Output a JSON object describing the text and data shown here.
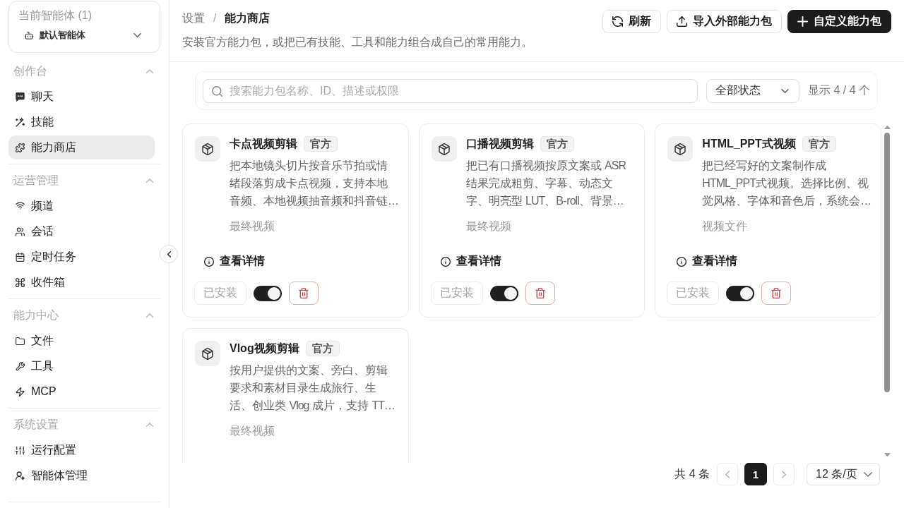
{
  "sidebar": {
    "agent_picker": {
      "label": "当前智能体 (1)",
      "value": "默认智能体"
    },
    "sections": [
      {
        "title": "创作台",
        "expanded": true,
        "items": [
          {
            "label": "聊天",
            "kind": "chat",
            "selected": false
          },
          {
            "label": "技能",
            "kind": "skills",
            "selected": false
          },
          {
            "label": "能力商店",
            "kind": "store",
            "selected": true
          }
        ]
      },
      {
        "title": "运营管理",
        "expanded": true,
        "items": [
          {
            "label": "频道",
            "kind": "channels",
            "selected": false
          },
          {
            "label": "会话",
            "kind": "sessions",
            "selected": false
          },
          {
            "label": "定时任务",
            "kind": "schedule",
            "selected": false
          },
          {
            "label": "收件箱",
            "kind": "inbox",
            "selected": false
          }
        ]
      },
      {
        "title": "能力中心",
        "expanded": true,
        "items": [
          {
            "label": "文件",
            "kind": "files",
            "selected": false
          },
          {
            "label": "工具",
            "kind": "tools",
            "selected": false
          },
          {
            "label": "MCP",
            "kind": "mcp",
            "selected": false
          }
        ]
      },
      {
        "title": "系统设置",
        "expanded": true,
        "items": [
          {
            "label": "运行配置",
            "kind": "runtime",
            "selected": false
          },
          {
            "label": "智能体管理",
            "kind": "agents",
            "selected": false
          }
        ]
      }
    ]
  },
  "header": {
    "breadcrumb": [
      {
        "label": "设置",
        "current": false
      },
      {
        "label": "能力商店",
        "current": true
      }
    ],
    "separator": "/",
    "subtitle": "安装官方能力包，或把已有技能、工具和能力组合成自己的常用能力。",
    "buttons": [
      {
        "label": "刷新",
        "kind": "refresh"
      },
      {
        "label": "导入外部能力包",
        "kind": "import"
      },
      {
        "label": "自定义能力包",
        "kind": "create"
      }
    ]
  },
  "filter": {
    "search": {
      "placeholder": "搜索能力包名称、ID、描述或权限"
    },
    "status_select": {
      "value": "全部状态"
    },
    "result_count": "显示 4 / 4 个"
  },
  "cards": [
    {
      "title": "卡点视频剪辑",
      "badge": "官方",
      "description": "把本地镜头切片按音乐节拍或情绪段落剪成卡点视频，支持本地音频、本地视频抽音频和抖音链…",
      "output": "最终视频",
      "details_link": "查看详情",
      "install_button": {
        "label": "已安装",
        "disabled": true
      },
      "enabled": true
    },
    {
      "title": "口播视频剪辑",
      "badge": "官方",
      "description": "把已有口播视频按原文案或 ASR 结果完成粗剪、字幕、动态文字、明亮型 LUT、B-roll、背景…",
      "output": "最终视频",
      "details_link": "查看详情",
      "install_button": {
        "label": "已安装",
        "disabled": true
      },
      "enabled": true
    },
    {
      "title": "HTML_PPT式视频",
      "badge": "官方",
      "description": "把已经写好的文案制作成HTML_PPT式视频。选择比例、视觉风格、字体和音色后，系统会…",
      "output": "视频文件",
      "details_link": "查看详情",
      "install_button": {
        "label": "已安装",
        "disabled": true
      },
      "enabled": true
    },
    {
      "title": "Vlog视频剪辑",
      "badge": "官方",
      "description": "按用户提供的文案、旁白、剪辑要求和素材目录生成旅行、生活、创业类 Vlog 成片，支持 TT…",
      "output": "最终视频"
    }
  ],
  "pagination": {
    "total": "共 4 条",
    "prev": {
      "disabled": true
    },
    "pages": [
      {
        "label": "1",
        "selected": true
      }
    ],
    "next": {
      "disabled": true
    },
    "page_size": "12 条/页"
  }
}
